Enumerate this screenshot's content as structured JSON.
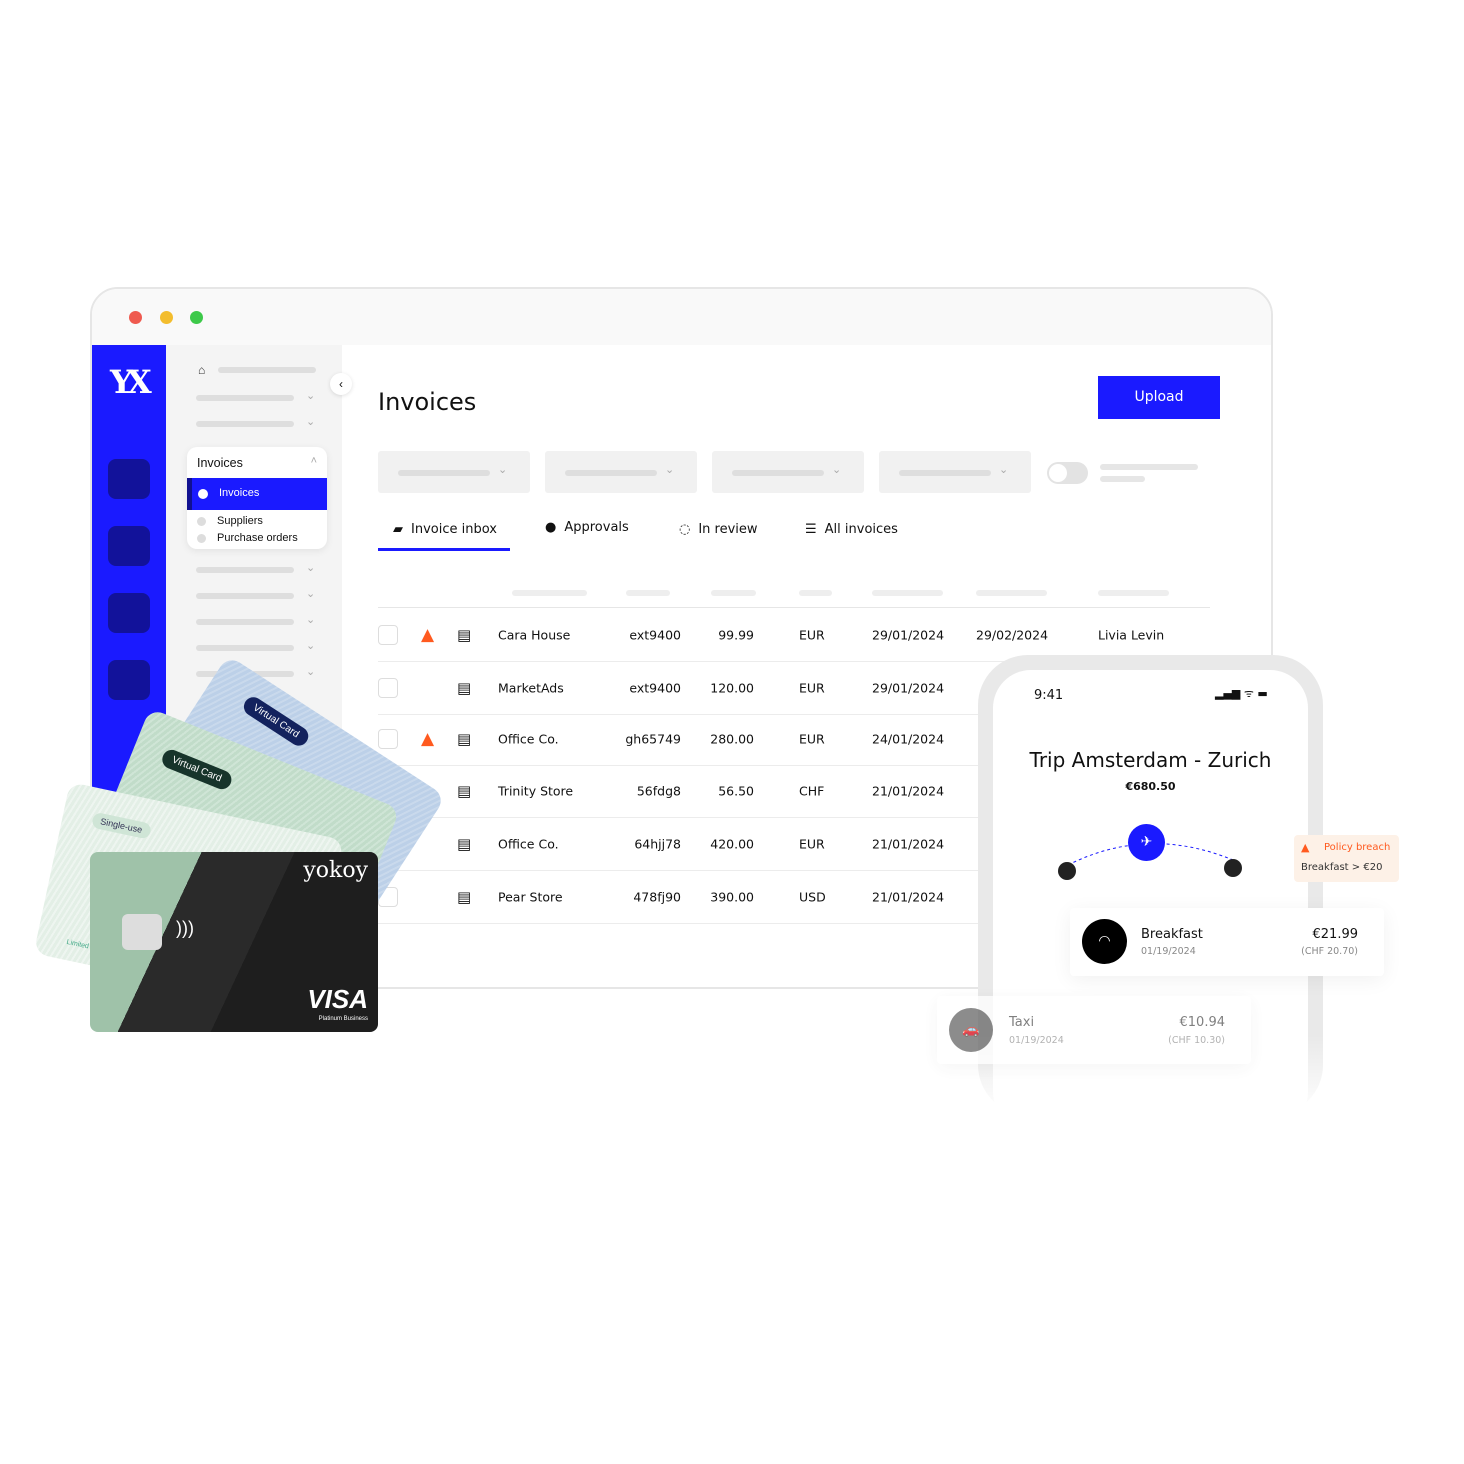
{
  "window": {
    "controls": [
      "close",
      "minimize",
      "maximize"
    ],
    "control_colors": [
      "#ef5a4f",
      "#f3bd2e",
      "#3dc94a"
    ]
  },
  "sidebar": {
    "logo": "YX",
    "accent": "#1a1aff",
    "menu": {
      "title": "Invoices",
      "items": [
        {
          "label": "Invoices",
          "active": true
        },
        {
          "label": "Suppliers"
        },
        {
          "label": "Purchase orders"
        }
      ]
    }
  },
  "header": {
    "title": "Invoices",
    "upload_label": "Upload"
  },
  "tabs": [
    {
      "label": "Invoice inbox",
      "icon": "inbox-icon",
      "active": true
    },
    {
      "label": "Approvals",
      "icon": "check-circle-filled-icon"
    },
    {
      "label": "In review",
      "icon": "check-circle-outline-icon"
    },
    {
      "label": "All invoices",
      "icon": "list-icon"
    }
  ],
  "rows": [
    {
      "warning": true,
      "name": "Cara House",
      "ref": "ext9400",
      "amount": "99.99",
      "currency": "EUR",
      "date": "29/01/2024",
      "due": "29/02/2024",
      "owner": "Livia Levin"
    },
    {
      "warning": false,
      "name": "MarketAds",
      "ref": "ext9400",
      "amount": "120.00",
      "currency": "EUR",
      "date": "29/01/2024"
    },
    {
      "warning": true,
      "name": "Office Co.",
      "ref": "gh65749",
      "amount": "280.00",
      "currency": "EUR",
      "date": "24/01/2024"
    },
    {
      "warning": false,
      "name": "Trinity Store",
      "ref": "56fdg8",
      "amount": "56.50",
      "currency": "CHF",
      "date": "21/01/2024"
    },
    {
      "warning": false,
      "name": "Office Co.",
      "ref": "64hjj78",
      "amount": "420.00",
      "currency": "EUR",
      "date": "21/01/2024"
    },
    {
      "warning": false,
      "name": "Pear Store",
      "ref": "478fj90",
      "amount": "390.00",
      "currency": "USD",
      "date": "21/01/2024"
    }
  ],
  "phone": {
    "time": "9:41",
    "trip_title": "Trip Amsterdam - Zurich",
    "trip_total": "€680.50",
    "expenses": [
      {
        "name": "Breakfast",
        "date": "01/19/2024",
        "amount": "€21.99",
        "converted": "(CHF 20.70)",
        "icon": "croissant-icon"
      },
      {
        "name": "Taxi",
        "date": "01/19/2024",
        "amount": "€10.94",
        "converted": "(CHF 10.30)",
        "icon": "car-icon"
      }
    ],
    "policy": {
      "title": "Policy breach",
      "detail": "Breakfast > €20",
      "color": "#ff5a1f"
    }
  },
  "cards": {
    "brand": "yokoy",
    "labels": [
      "Virtual Card",
      "Virtual Card",
      "Single-use",
      "Limited"
    ],
    "network": "VISA",
    "tier": "Platinum Business"
  }
}
